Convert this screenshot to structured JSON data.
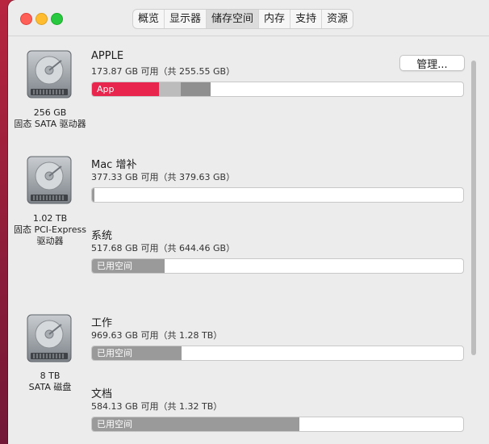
{
  "tabs": [
    {
      "label": "概览"
    },
    {
      "label": "显示器"
    },
    {
      "label": "储存空间",
      "active": true
    },
    {
      "label": "内存"
    },
    {
      "label": "支持"
    },
    {
      "label": "资源"
    }
  ],
  "disks": [
    {
      "capacity": "256 GB",
      "type": "固态 SATA 驱动器",
      "volumes": [
        {
          "name": "APPLE",
          "available": "173.87 GB 可用（共 255.55 GB）",
          "manage_label": "管理...",
          "usage": {
            "app_label": "App",
            "app_fraction": 0.18,
            "other_fraction": 0.06,
            "system_fraction": 0.08
          }
        }
      ]
    },
    {
      "capacity": "1.02 TB",
      "type_line1": "固态 PCI-Express",
      "type_line2": "驱动器",
      "volumes": [
        {
          "name": "Mac 增补",
          "available": "377.33 GB 可用（共 379.63 GB）",
          "used_fraction": 0.006
        },
        {
          "name": "系统",
          "available": "517.68 GB 可用（共 644.46 GB）",
          "used_label": "已用空间",
          "used_fraction": 0.196
        }
      ]
    },
    {
      "capacity": "8 TB",
      "type": "SATA 磁盘",
      "volumes": [
        {
          "name": "工作",
          "available": "969.63 GB 可用（共 1.28 TB）",
          "used_label": "已用空间",
          "used_fraction": 0.242
        },
        {
          "name": "文档",
          "available": "584.13 GB 可用（共 1.32 TB）",
          "used_label": "已用空间",
          "used_fraction": 0.558
        }
      ]
    }
  ],
  "colors": {
    "app": "#e8264d",
    "other": "#bcbcbc",
    "system": "#8f8f8f",
    "used": "#9a9a9a"
  }
}
